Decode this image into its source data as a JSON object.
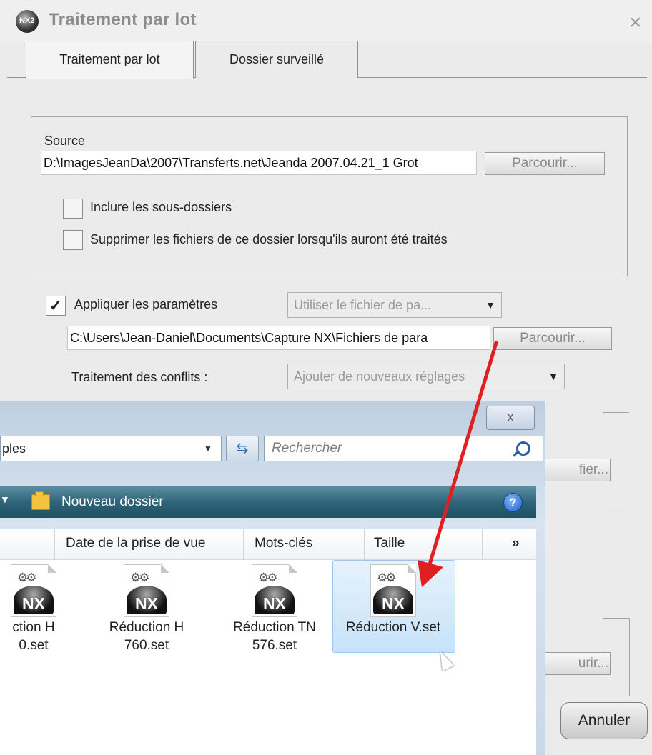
{
  "batch_dialog": {
    "title": "Traitement par lot",
    "tabs": [
      {
        "label": "Traitement par lot"
      },
      {
        "label": "Dossier surveillé"
      }
    ],
    "source": {
      "label": "Source",
      "path_value": "D:\\ImagesJeanDa\\2007\\Transferts.net\\Jeanda 2007.04.21_1 Grot",
      "browse_label": "Parcourir...",
      "include_subfolders_label": "Inclure les sous-dossiers",
      "delete_after_label": "Supprimer les fichiers de ce dossier lorsqu'ils auront été traités"
    },
    "apply_settings": {
      "label": "Appliquer les paramètres",
      "checked": true,
      "mode_value": "Utiliser le fichier de pa...",
      "file_path_value": "C:\\Users\\Jean-Daniel\\Documents\\Capture NX\\Fichiers de para",
      "browse_label": "Parcourir...",
      "conflicts_label": "Traitement des conflits :",
      "conflicts_value": "Ajouter de nouveaux réglages"
    },
    "partial_buttons": [
      {
        "label": "fier..."
      },
      {
        "label": "urir..."
      }
    ],
    "cancel_label": "Annuler"
  },
  "file_dialog": {
    "close_glyph": "x",
    "address_value": "ples",
    "search_placeholder": "Rechercher",
    "toolbar": {
      "new_folder_label": "Nouveau dossier"
    },
    "columns": [
      {
        "label": "Date de la prise de vue"
      },
      {
        "label": "Mots-clés"
      },
      {
        "label": "Taille"
      },
      {
        "label": "»"
      }
    ],
    "files": [
      {
        "line1": "ction H",
        "line2": "0.set"
      },
      {
        "line1": "Réduction H",
        "line2": "760.set"
      },
      {
        "line1": "Réduction TN",
        "line2": "576.set"
      },
      {
        "line1": "Réduction V.set",
        "line2": "",
        "selected": true
      }
    ]
  },
  "colors": {
    "annotation_arrow": "#e02020",
    "vista_toolbar": "#2f6479",
    "selection": "#c7e2f9"
  },
  "icons": {
    "app": "nx2-logo-icon",
    "file": "nx-settings-file-icon",
    "folder": "new-folder-icon",
    "help": "help-icon",
    "search": "search-icon"
  }
}
